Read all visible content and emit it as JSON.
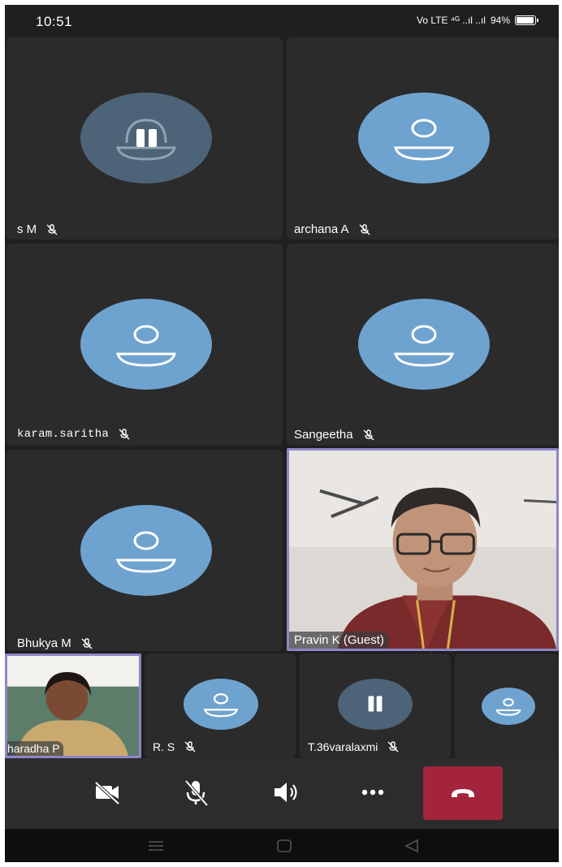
{
  "status_bar": {
    "time": "10:51",
    "indicators": "Vo LTE ⁴ᴳ ..ıl ..ıl",
    "battery": "94%"
  },
  "participants": [
    {
      "name": "s M",
      "state": "paused",
      "mic": "muted"
    },
    {
      "name": "archana A",
      "state": "avatar",
      "mic": "muted"
    },
    {
      "name": "karam.saritha",
      "state": "avatar",
      "mic": "muted"
    },
    {
      "name": "Sangeetha",
      "state": "avatar",
      "mic": "muted"
    },
    {
      "name": "Bhukya M",
      "state": "avatar",
      "mic": "muted"
    },
    {
      "name": "Pravin K (Guest)",
      "state": "video",
      "active_speaker": true
    },
    {
      "name": "haradha P",
      "state": "video"
    },
    {
      "name": "R. S",
      "state": "avatar",
      "mic": "muted"
    },
    {
      "name": "T.36varalaxmi",
      "state": "paused",
      "mic": "muted"
    },
    {
      "name": "",
      "state": "avatar"
    }
  ],
  "controls": [
    {
      "name": "camera-off",
      "icon": "video-off-icon"
    },
    {
      "name": "mic-off",
      "icon": "mic-off-icon"
    },
    {
      "name": "speaker",
      "icon": "speaker-icon"
    },
    {
      "name": "more",
      "icon": "more-dots-icon"
    },
    {
      "name": "end-call",
      "icon": "hang-up-icon",
      "color": "#a5243d"
    }
  ],
  "colors": {
    "tile_bg": "#2b2b2c",
    "avatar": "#6fa3cf",
    "paused_avatar": "#4d6378",
    "active_border": "#8e86c9"
  }
}
